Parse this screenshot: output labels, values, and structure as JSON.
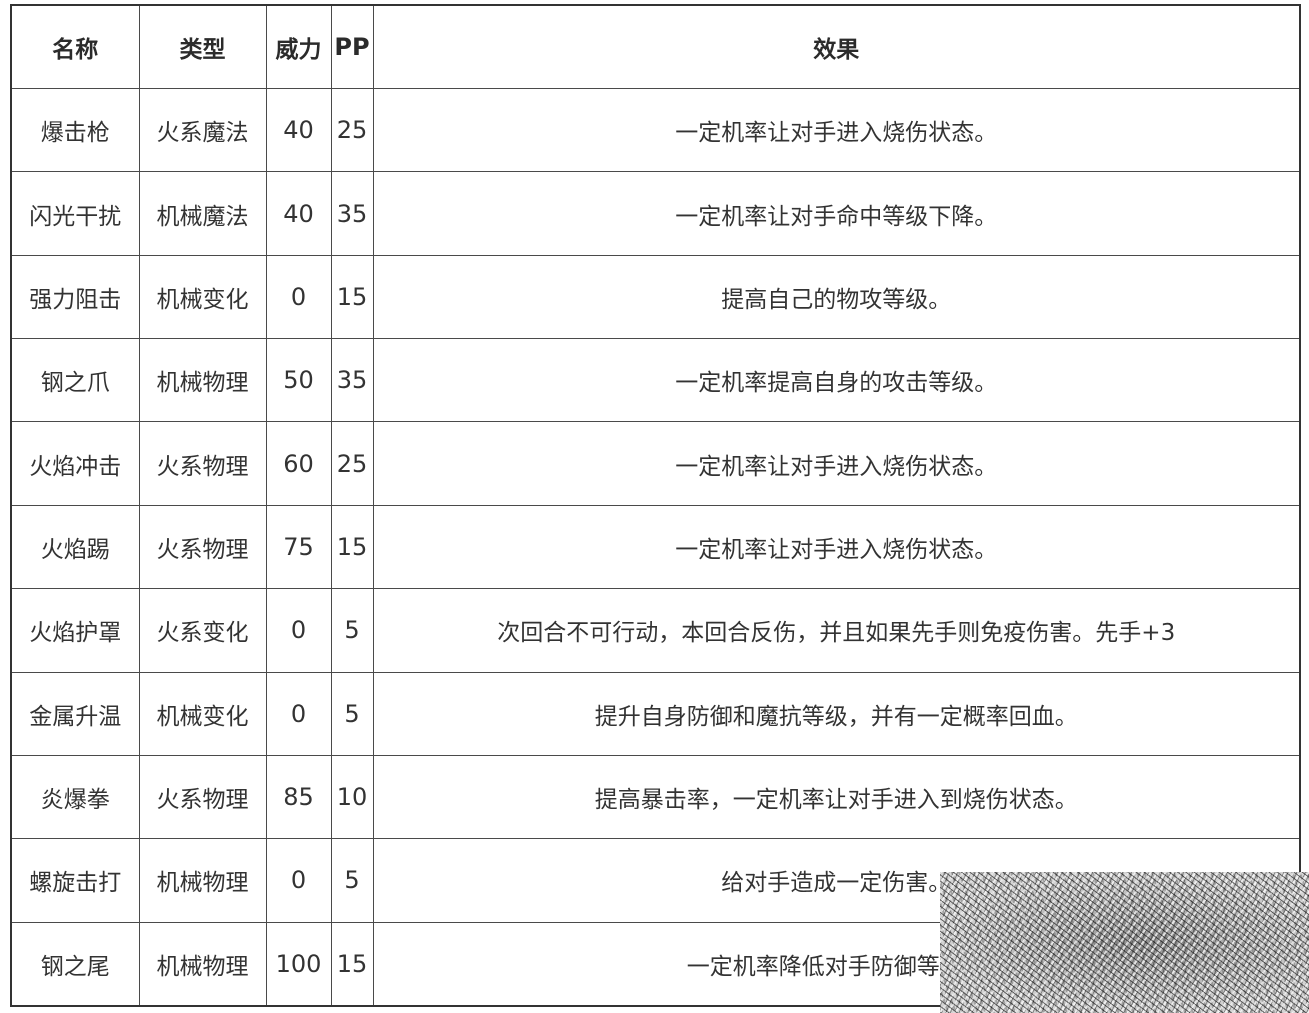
{
  "table": {
    "headers": {
      "name": "名称",
      "type": "类型",
      "power": "威力",
      "pp": "PP",
      "effect": "效果"
    },
    "rows": [
      {
        "name": "爆击枪",
        "type": "火系魔法",
        "power": "40",
        "pp": "25",
        "effect": "一定机率让对手进入烧伤状态。"
      },
      {
        "name": "闪光干扰",
        "type": "机械魔法",
        "power": "40",
        "pp": "35",
        "effect": "一定机率让对手命中等级下降。"
      },
      {
        "name": "强力阻击",
        "type": "机械变化",
        "power": "0",
        "pp": "15",
        "effect": "提高自己的物攻等级。"
      },
      {
        "name": "钢之爪",
        "type": "机械物理",
        "power": "50",
        "pp": "35",
        "effect": "一定机率提高自身的攻击等级。"
      },
      {
        "name": "火焰冲击",
        "type": "火系物理",
        "power": "60",
        "pp": "25",
        "effect": "一定机率让对手进入烧伤状态。"
      },
      {
        "name": "火焰踢",
        "type": "火系物理",
        "power": "75",
        "pp": "15",
        "effect": "一定机率让对手进入烧伤状态。"
      },
      {
        "name": "火焰护罩",
        "type": "火系变化",
        "power": "0",
        "pp": "5",
        "effect": "次回合不可行动，本回合反伤，并且如果先手则免疫伤害。先手+3"
      },
      {
        "name": "金属升温",
        "type": "机械变化",
        "power": "0",
        "pp": "5",
        "effect": "提升自身防御和魔抗等级，并有一定概率回血。"
      },
      {
        "name": "炎爆拳",
        "type": "火系物理",
        "power": "85",
        "pp": "10",
        "effect": "提高暴击率，一定机率让对手进入到烧伤状态。"
      },
      {
        "name": "螺旋击打",
        "type": "机械物理",
        "power": "0",
        "pp": "5",
        "effect": "给对手造成一定伤害。"
      },
      {
        "name": "钢之尾",
        "type": "机械物理",
        "power": "100",
        "pp": "15",
        "effect": "一定机率降低对手防御等级。"
      }
    ]
  }
}
